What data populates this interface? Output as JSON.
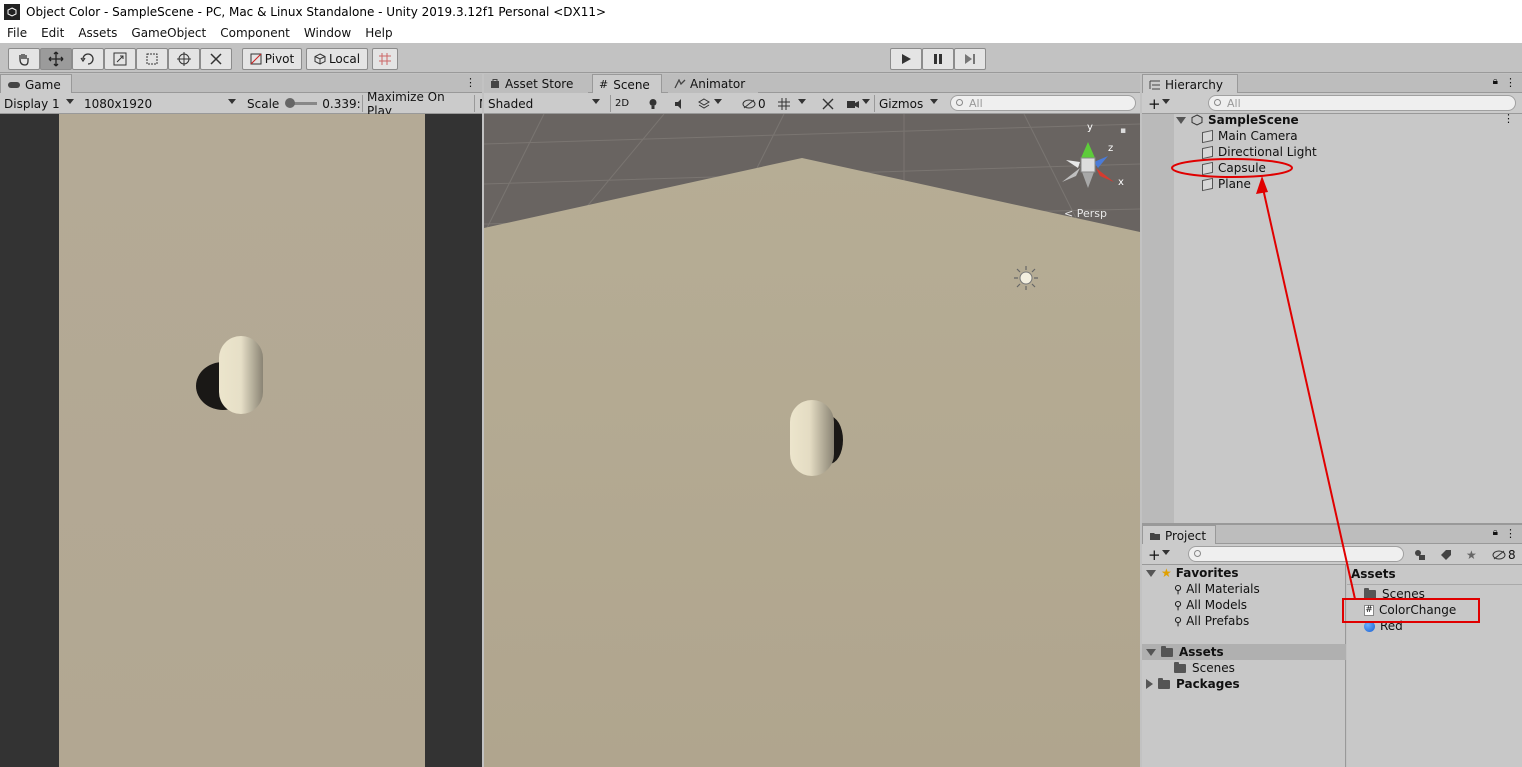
{
  "window": {
    "title": "Object Color - SampleScene - PC, Mac & Linux Standalone - Unity 2019.3.12f1 Personal <DX11>"
  },
  "menu": [
    "File",
    "Edit",
    "Assets",
    "GameObject",
    "Component",
    "Window",
    "Help"
  ],
  "toolbar": {
    "pivot_label": "Pivot",
    "local_label": "Local"
  },
  "game_panel": {
    "tab": "Game",
    "display": "Display 1",
    "resolution": "1080x1920",
    "scale_label": "Scale",
    "scale_value": "0.339:",
    "maximize": "Maximize On Play",
    "extra": "M"
  },
  "scene_panel": {
    "tabs": [
      "Asset Store",
      "Scene",
      "Animator"
    ],
    "shading": "Shaded",
    "mode_2d": "2D",
    "hidden_count": "0",
    "gizmos": "Gizmos",
    "search_placeholder": "All",
    "persp_label": "< Persp",
    "axes": {
      "x": "x",
      "y": "y",
      "z": "z"
    }
  },
  "hierarchy": {
    "tab": "Hierarchy",
    "search_placeholder": "All",
    "scene": "SampleScene",
    "items": [
      "Main Camera",
      "Directional Light",
      "Capsule",
      "Plane"
    ]
  },
  "project": {
    "tab": "Project",
    "hidden_count": "8",
    "favorites_label": "Favorites",
    "favorites": [
      "All Materials",
      "All Models",
      "All Prefabs"
    ],
    "assets_label": "Assets",
    "assets_children": [
      "Scenes"
    ],
    "packages_label": "Packages",
    "content_header": "Assets",
    "content_items": [
      {
        "name": "Scenes",
        "kind": "folder"
      },
      {
        "name": "ColorChange",
        "kind": "script"
      },
      {
        "name": "Red",
        "kind": "material"
      }
    ]
  },
  "colors": {
    "annotation": "#e00000",
    "ground": "#b3a88f",
    "scene_backdrop": "#696461"
  }
}
